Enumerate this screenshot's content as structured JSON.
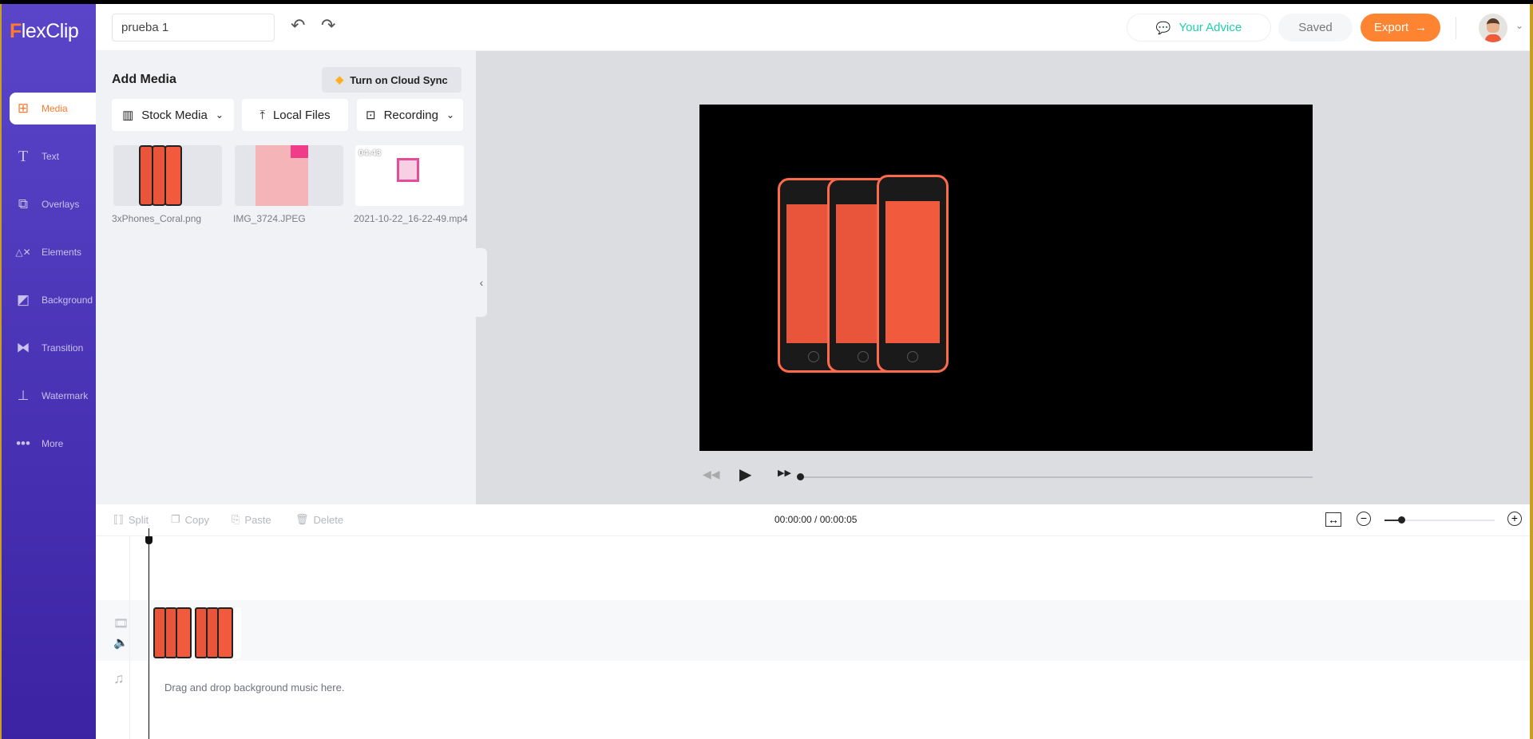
{
  "app": {
    "logo_first": "F",
    "logo_rest": "lexClip"
  },
  "sidebar": {
    "items": [
      {
        "label": "Media",
        "icon": "folder-plus-icon",
        "active": true
      },
      {
        "label": "Text",
        "icon": "text-icon"
      },
      {
        "label": "Overlays",
        "icon": "overlays-icon"
      },
      {
        "label": "Elements",
        "icon": "elements-icon"
      },
      {
        "label": "Background",
        "icon": "background-icon"
      },
      {
        "label": "Transition",
        "icon": "transition-icon"
      },
      {
        "label": "Watermark",
        "icon": "watermark-icon"
      },
      {
        "label": "More",
        "icon": "more-icon"
      }
    ]
  },
  "header": {
    "project_name": "prueba 1",
    "advice": "Your Advice",
    "saved": "Saved",
    "export": "Export",
    "accent": "#ff8432",
    "advice_color": "#1fcfb0"
  },
  "panel": {
    "title": "Add Media",
    "cloud_sync": "Turn on Cloud Sync",
    "stock_media": "Stock Media",
    "local_files": "Local Files",
    "recording": "Recording",
    "media": [
      {
        "name": "3xPhones_Coral.png"
      },
      {
        "name": "IMG_3724.JPEG"
      },
      {
        "name": "2021-10-22_16-22-49.mp4",
        "duration": "04:43"
      }
    ]
  },
  "player": {
    "progress": 0
  },
  "toolbar": {
    "split": "Split",
    "copy": "Copy",
    "paste": "Paste",
    "delete": "Delete",
    "time": "00:00:00 / 00:00:05",
    "zoom_level": 0.15
  },
  "timeline": {
    "music_hint": "Drag and drop background music here."
  }
}
